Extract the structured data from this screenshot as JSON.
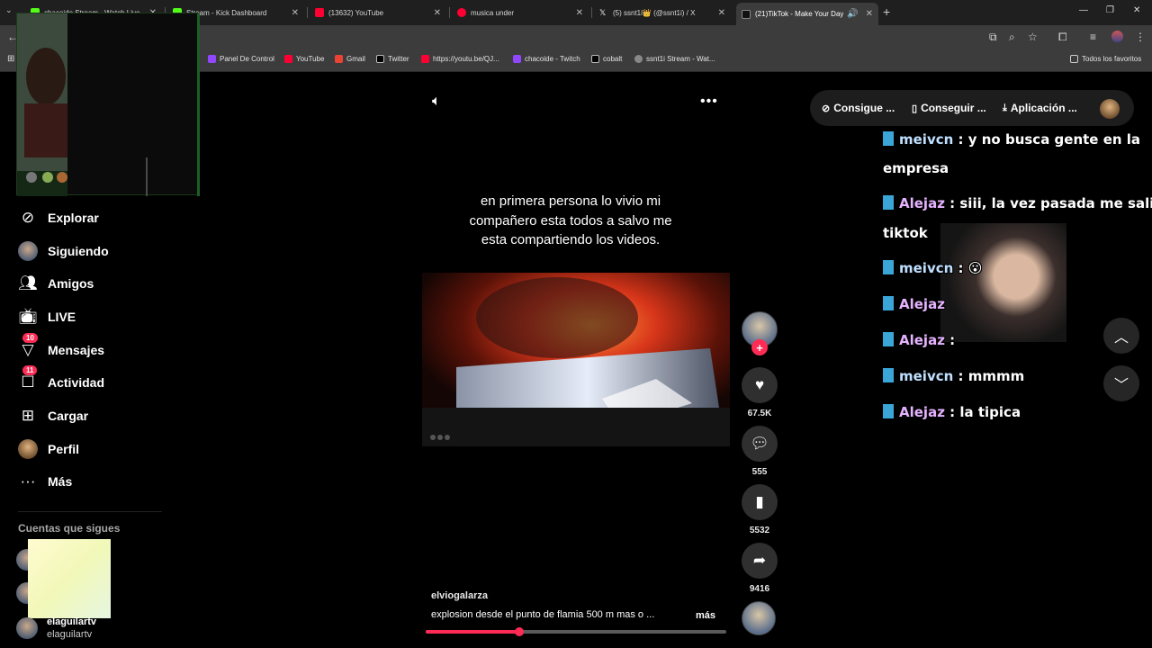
{
  "browser": {
    "tabs": [
      {
        "title": "chacoide Stream - Watch Live",
        "favcolor": "#53fc18"
      },
      {
        "title": "Stream - Kick Dashboard",
        "favcolor": "#53fc18"
      },
      {
        "title": "(13632) YouTube",
        "favcolor": "#ff0033"
      },
      {
        "title": "musica under",
        "favcolor": "#ff0033"
      },
      {
        "title": "(5) ssnt1i👑 (@ssnt1i) / X",
        "favcolor": "#ffffff"
      },
      {
        "title": "(21)TikTok - Make Your Day",
        "favcolor": "#111111"
      }
    ],
    "bookmarks": [
      {
        "label": "Panel De Control",
        "color": "#9146ff"
      },
      {
        "label": "YouTube",
        "color": "#ff0033"
      },
      {
        "label": "Gmail",
        "color": "#ea4335"
      },
      {
        "label": "Twitter",
        "color": "#ffffff"
      },
      {
        "label": "https://youtu.be/QJ...",
        "color": "#ff0033"
      },
      {
        "label": "chacoide - Twitch",
        "color": "#9146ff"
      },
      {
        "label": "cobalt",
        "color": "#ffffff"
      },
      {
        "label": "ssnt1i Stream - Wat...",
        "color": "#bbbbbb"
      }
    ],
    "all_favorites": "Todos los favoritos"
  },
  "sidebar": {
    "items": [
      {
        "label": "Explorar",
        "icon": "compass-icon"
      },
      {
        "label": "Siguiendo",
        "icon": "following-avatar-icon"
      },
      {
        "label": "Amigos",
        "icon": "friends-icon"
      },
      {
        "label": "LIVE",
        "icon": "live-tv-icon"
      },
      {
        "label": "Mensajes",
        "icon": "messages-icon",
        "badge": "10"
      },
      {
        "label": "Actividad",
        "icon": "activity-icon",
        "badge": "11"
      },
      {
        "label": "Cargar",
        "icon": "upload-icon"
      },
      {
        "label": "Perfil",
        "icon": "profile-avatar-icon"
      },
      {
        "label": "Más",
        "icon": "more-dots-icon"
      }
    ],
    "following_title": "Cuentas que sigues",
    "followed": [
      {
        "name": "elaguilartv",
        "sub": "elaguilartv"
      }
    ]
  },
  "video": {
    "overlay_text": "en primera persona lo vivio mi compañero esta todos a salvo me esta compartiendo los videos.",
    "author": "elviogalarza",
    "caption": "explosion desde el punto de flamia 500 m mas o ...",
    "more": "más",
    "progress": 0.31
  },
  "actions": {
    "likes": "67.5K",
    "comments": "555",
    "saves": "5532",
    "shares": "9416"
  },
  "top_buttons": {
    "coins": "Consigue ...",
    "get": "Conseguir ...",
    "app": "Aplicación ..."
  },
  "chat": [
    {
      "user": "meivcn",
      "msg": ": y no busca gente en la"
    },
    {
      "user": "",
      "msg": "empresa"
    },
    {
      "user": "Alejaz",
      "msg": ": siii, la vez pasada me salió su"
    },
    {
      "user": "",
      "msg": "tiktok"
    },
    {
      "user": "meivcn",
      "msg": ": 😮"
    },
    {
      "user": "Alejaz",
      "msg": ""
    },
    {
      "user": "Alejaz",
      "msg": ":"
    },
    {
      "user": "meivcn",
      "msg": ": mmmm"
    },
    {
      "user": "Alejaz",
      "msg": ": la tipica"
    }
  ],
  "colors": {
    "accent": "#fe2c55",
    "kick_badge": "#3aa6d8"
  }
}
